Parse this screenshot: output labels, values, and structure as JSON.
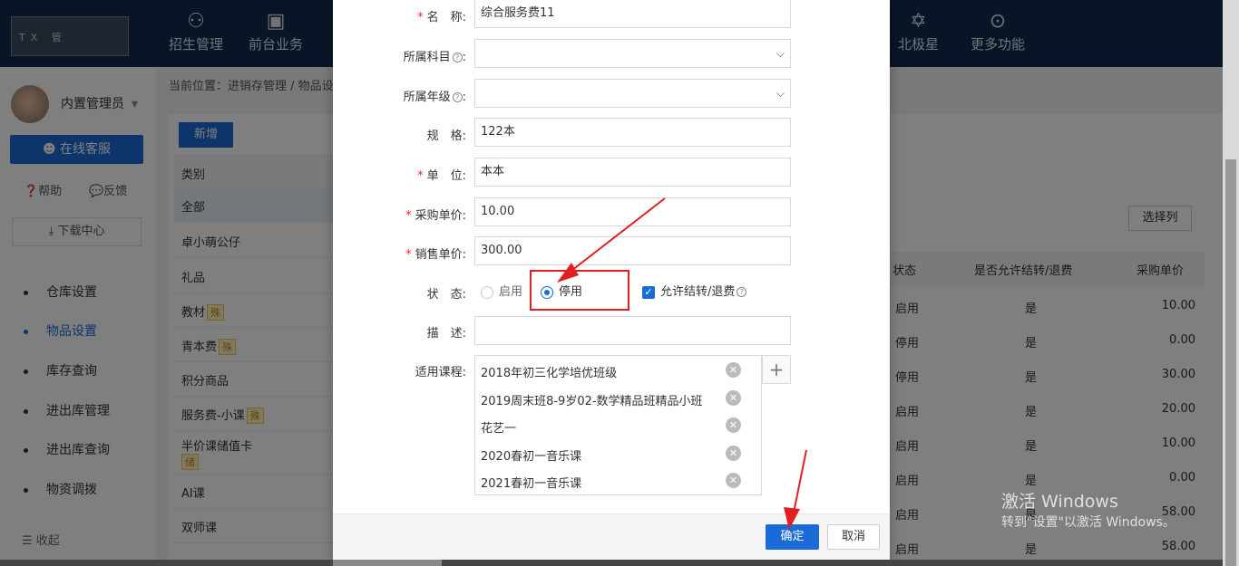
{
  "topbar": {
    "logo_text": "TX 管",
    "nav": [
      {
        "label": "招生管理",
        "icon": "person-add-icon"
      },
      {
        "label": "前台业务",
        "icon": "desk-icon"
      },
      {
        "label": "北极星",
        "icon": "star-icon"
      },
      {
        "label": "更多功能",
        "icon": "more-icon"
      }
    ]
  },
  "sidebar": {
    "user_name": "内置管理员",
    "service_label": "在线客服",
    "help_label": "帮助",
    "feedback_label": "反馈",
    "download_label": "下载中心",
    "menu": [
      "仓库设置",
      "物品设置",
      "库存查询",
      "进出库管理",
      "进出库查询",
      "物资调拨"
    ],
    "active_index": 1,
    "collapse_label": "收起"
  },
  "content": {
    "breadcrumb": "当前位置：进销存管理 / 物品设",
    "add_label": "新增",
    "category_header": "类别",
    "categories": [
      {
        "name": "全部",
        "tag": ""
      },
      {
        "name": "卓小萌公仔",
        "tag": ""
      },
      {
        "name": "礼品",
        "tag": ""
      },
      {
        "name": "教材",
        "tag": "殊"
      },
      {
        "name": "青本费",
        "tag": "殊"
      },
      {
        "name": "积分商品",
        "tag": ""
      },
      {
        "name": "服务费-小课",
        "tag": "殊"
      },
      {
        "name": "半价课储值卡",
        "tag": "储"
      },
      {
        "name": "AI课",
        "tag": ""
      },
      {
        "name": "双师课",
        "tag": ""
      }
    ],
    "choose_columns_label": "选择列",
    "table": {
      "headers": [
        "状态",
        "是否允许结转/退费",
        "采购单价"
      ],
      "rows": [
        [
          "启用",
          "是",
          "10.00"
        ],
        [
          "停用",
          "是",
          "0.00"
        ],
        [
          "停用",
          "是",
          "30.00"
        ],
        [
          "启用",
          "是",
          "20.00"
        ],
        [
          "启用",
          "是",
          "10.00"
        ],
        [
          "启用",
          "是",
          "0.00"
        ],
        [
          "启用",
          "是",
          "58.00"
        ],
        [
          "启用",
          "是",
          "58.00"
        ]
      ]
    }
  },
  "modal": {
    "fields": {
      "name_label": "名　称:",
      "name_value": "综合服务费11",
      "subject_label": "所属科目",
      "subject_value": "",
      "grade_label": "所属年级",
      "grade_value": "",
      "spec_label": "规　格:",
      "spec_value": "122本",
      "unit_label": "单　位:",
      "unit_value": "本本",
      "purchase_price_label": "采购单价:",
      "purchase_price_value": "10.00",
      "sale_price_label": "销售单价:",
      "sale_price_value": "300.00",
      "status_label": "状　态:",
      "status_enabled": "启用",
      "status_disabled": "停用",
      "status_selected": "停用",
      "allow_refund_label": "允许结转/退费",
      "allow_refund_checked": true,
      "desc_label": "描　述:",
      "desc_value": "",
      "courses_label": "适用课程:",
      "courses": [
        "2018年初三化学培优班级",
        "2019周末班8-9岁02-数学精品班精品小班",
        "花艺一",
        "2020春初一音乐课",
        "2021春初一音乐课"
      ]
    },
    "ok_label": "确定",
    "cancel_label": "取消"
  },
  "watermark": {
    "line1": "激活 Windows",
    "line2": "转到\"设置\"以激活 Windows。"
  },
  "colors": {
    "primary": "#1a6ad8",
    "nav_bg": "#0e2a4f",
    "highlight": "#e02020"
  }
}
